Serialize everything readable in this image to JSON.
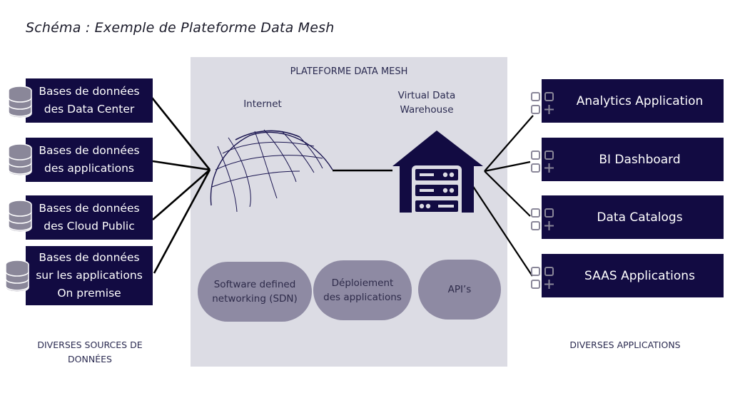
{
  "title": "Schéma  :  Exemple de Plateforme Data Mesh",
  "platform": {
    "title": "PLATEFORME DATA MESH",
    "internet_label": "Internet",
    "warehouse_label_line1": "Virtual Data",
    "warehouse_label_line2": "Warehouse",
    "services": [
      {
        "line1": "Software defined",
        "line2": "networking (SDN)"
      },
      {
        "line1": "Déploiement",
        "line2": "des applications"
      },
      {
        "line1": "API’s",
        "line2": ""
      }
    ]
  },
  "sources": {
    "items": [
      {
        "line1": "Bases de données",
        "line2": "des Data Center",
        "line3": ""
      },
      {
        "line1": "Bases de données",
        "line2": "des applications",
        "line3": ""
      },
      {
        "line1": "Bases de données",
        "line2": "des Cloud Public",
        "line3": ""
      },
      {
        "line1": "Bases de données",
        "line2": "sur les applications",
        "line3": "On premise"
      }
    ],
    "caption_line1": "DIVERSES SOURCES DE",
    "caption_line2": "DONNÉES",
    "icon": "database-icon"
  },
  "applications": {
    "items": [
      {
        "label": "Analytics Application"
      },
      {
        "label": "BI Dashboard"
      },
      {
        "label": "Data Catalogs"
      },
      {
        "label": "SAAS Applications"
      }
    ],
    "caption": "DIVERSES APPLICATIONS",
    "icon": "app-grid-icon"
  },
  "colors": {
    "navy": "#120b42",
    "platform_bg": "#dcdce4",
    "pill": "#8e8aa3",
    "icon_gray": "#8a8799"
  }
}
